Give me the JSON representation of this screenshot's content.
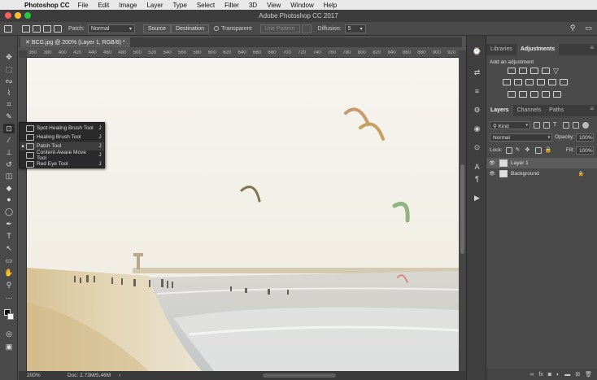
{
  "menubar": {
    "app_name": "Photoshop CC",
    "items": [
      "File",
      "Edit",
      "Image",
      "Layer",
      "Type",
      "Select",
      "Filter",
      "3D",
      "View",
      "Window",
      "Help"
    ]
  },
  "window": {
    "title": "Adobe Photoshop CC 2017"
  },
  "options": {
    "patch_label": "Patch:",
    "patch_mode": "Normal",
    "source_label": "Source",
    "destination_label": "Destination",
    "transparent_label": "Transparent",
    "use_pattern_label": "Use Pattern",
    "diffusion_label": "Diffusion:",
    "diffusion_value": "5"
  },
  "document": {
    "tab_label": "BCG.jpg @ 200% (Layer 1, RGB/8) *",
    "ruler_ticks": [
      "360",
      "380",
      "400",
      "420",
      "440",
      "460",
      "480",
      "500",
      "520",
      "540",
      "560",
      "580",
      "600",
      "620",
      "640",
      "660",
      "680",
      "700",
      "720",
      "740",
      "760",
      "780",
      "800",
      "820",
      "840",
      "860",
      "880",
      "900",
      "920"
    ],
    "status_zoom": "200%",
    "status_doc": "Doc: 2.73M/5.46M"
  },
  "flyout": {
    "items": [
      {
        "label": "Spot Healing Brush Tool",
        "shortcut": "J",
        "selected": false
      },
      {
        "label": "Healing Brush Tool",
        "shortcut": "J",
        "selected": false
      },
      {
        "label": "Patch Tool",
        "shortcut": "J",
        "selected": true
      },
      {
        "label": "Content-Aware Move Tool",
        "shortcut": "J",
        "selected": false
      },
      {
        "label": "Red Eye Tool",
        "shortcut": "J",
        "selected": false
      }
    ]
  },
  "panels": {
    "top_tabs": [
      "Libraries",
      "Adjustments"
    ],
    "adjustments_title": "Add an adjustment",
    "layer_tabs": [
      "Layers",
      "Channels",
      "Paths"
    ],
    "kind_label": "Kind",
    "blend_mode": "Normal",
    "opacity_label": "Opacity:",
    "opacity_value": "100%",
    "lock_label": "Lock:",
    "fill_label": "Fill:",
    "fill_value": "100%",
    "layers": [
      {
        "name": "Layer 1",
        "selected": true,
        "locked": false
      },
      {
        "name": "Background",
        "selected": false,
        "locked": true
      }
    ],
    "footer_icons": [
      "link-icon",
      "fx-icon",
      "mask-icon",
      "adjustment-icon",
      "folder-icon",
      "new-layer-icon",
      "trash-icon"
    ]
  },
  "colors": {
    "accent": "#3b8ed8",
    "app_bg": "#535353",
    "panel_bg": "#4a4a4a",
    "canvas_sky": "#f4f1ea",
    "sand": "#d9c59c"
  }
}
